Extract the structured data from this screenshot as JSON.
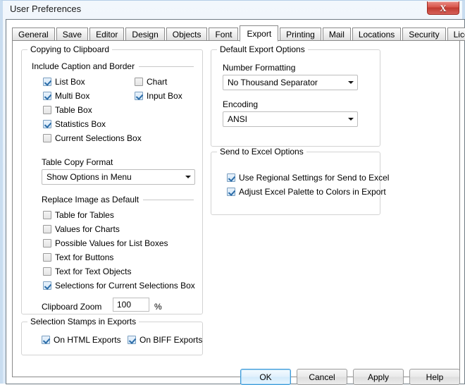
{
  "window": {
    "title": "User Preferences",
    "close_icon": "close-icon",
    "close_label": "X"
  },
  "tabs": [
    {
      "label": "General",
      "active": false
    },
    {
      "label": "Save",
      "active": false
    },
    {
      "label": "Editor",
      "active": false
    },
    {
      "label": "Design",
      "active": false
    },
    {
      "label": "Objects",
      "active": false
    },
    {
      "label": "Font",
      "active": false
    },
    {
      "label": "Export",
      "active": true
    },
    {
      "label": "Printing",
      "active": false
    },
    {
      "label": "Mail",
      "active": false
    },
    {
      "label": "Locations",
      "active": false
    },
    {
      "label": "Security",
      "active": false
    },
    {
      "label": "License",
      "active": false
    }
  ],
  "copying_to_clipboard": {
    "group_label": "Copying to Clipboard",
    "include_caption_header": "Include Caption and Border",
    "checkboxes_left": [
      {
        "label": "List Box",
        "checked": true
      },
      {
        "label": "Multi Box",
        "checked": true
      },
      {
        "label": "Table Box",
        "checked": false
      },
      {
        "label": "Statistics Box",
        "checked": true
      },
      {
        "label": "Current Selections Box",
        "checked": false
      }
    ],
    "checkboxes_right": [
      {
        "label": "Chart",
        "checked": false
      },
      {
        "label": "Input Box",
        "checked": true
      }
    ],
    "table_copy_format_label": "Table Copy Format",
    "table_copy_format_value": "Show Options in Menu",
    "replace_image_header": "Replace Image as Default",
    "replace_image_checkboxes": [
      {
        "label": "Table for Tables",
        "checked": false
      },
      {
        "label": "Values for Charts",
        "checked": false
      },
      {
        "label": "Possible Values for List Boxes",
        "checked": false
      },
      {
        "label": "Text for Buttons",
        "checked": false
      },
      {
        "label": "Text for Text Objects",
        "checked": false
      },
      {
        "label": "Selections for Current Selections Box",
        "checked": true
      }
    ],
    "clipboard_zoom_label": "Clipboard Zoom",
    "clipboard_zoom_value": "100",
    "clipboard_zoom_unit": "%"
  },
  "selection_stamps": {
    "group_label": "Selection Stamps in Exports",
    "checkboxes": [
      {
        "label": "On HTML Exports",
        "checked": true
      },
      {
        "label": "On BIFF Exports",
        "checked": true
      }
    ]
  },
  "default_export_options": {
    "group_label": "Default Export Options",
    "number_formatting_label": "Number Formatting",
    "number_formatting_value": "No Thousand Separator",
    "encoding_label": "Encoding",
    "encoding_value": "ANSI"
  },
  "send_to_excel": {
    "group_label": "Send to Excel Options",
    "checkboxes": [
      {
        "label": "Use Regional Settings for Send to Excel",
        "checked": true
      },
      {
        "label": "Adjust Excel Palette to Colors in Export",
        "checked": true
      }
    ]
  },
  "buttons": {
    "ok": "OK",
    "cancel": "Cancel",
    "apply": "Apply",
    "help": "Help"
  },
  "colors": {
    "accent": "#3c9ad9",
    "close_red": "#c03a30",
    "check_blue": "#2b6ca8"
  }
}
